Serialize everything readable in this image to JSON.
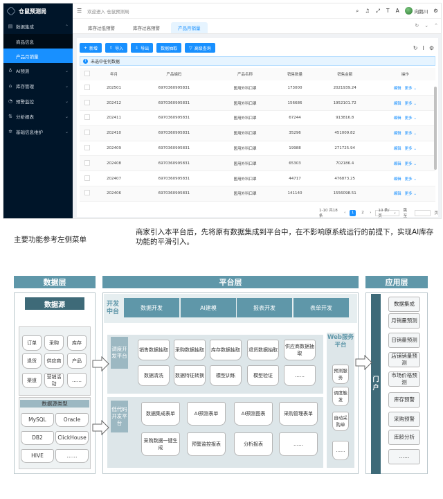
{
  "app": {
    "logo_text": "仓鼠预测局",
    "breadcrumb": "欢迎进入 仓鼠预测局",
    "user_name": "向鹅川",
    "sidebar": [
      {
        "label": "数据集成",
        "icon": "database-icon",
        "expanded": true,
        "children": [
          {
            "label": "商品信息",
            "active": false
          },
          {
            "label": "产品月销量",
            "active": true
          }
        ]
      },
      {
        "label": "AI预测",
        "icon": "bulb-icon"
      },
      {
        "label": "库存管理",
        "icon": "inventory-icon"
      },
      {
        "label": "预警监控",
        "icon": "alert-icon"
      },
      {
        "label": "分析报表",
        "icon": "report-icon"
      },
      {
        "label": "基础信息维护",
        "icon": "settings-icon"
      }
    ],
    "tabs": [
      {
        "label": "库存过低预警",
        "active": false
      },
      {
        "label": "库存过高预警",
        "active": false
      },
      {
        "label": "产品月销量",
        "active": true
      }
    ],
    "toolbar": {
      "add": "新增",
      "import": "导入",
      "export": "导出",
      "fetch": "数据抽取",
      "advanced": "高级查询"
    },
    "alert": "未选中任何数据",
    "columns": [
      "年月",
      "产品编码",
      "产品名称",
      "销售数量",
      "销售金额",
      "操作"
    ],
    "rows": [
      {
        "ym": "202501",
        "code": "6970360995831",
        "name": "医用外科口罩",
        "qty": "173000",
        "amount": "2021939.24"
      },
      {
        "ym": "202412",
        "code": "6970360995831",
        "name": "医用外科口罩",
        "qty": "156686",
        "amount": "1952101.72"
      },
      {
        "ym": "202411",
        "code": "6970360995831",
        "name": "医用外科口罩",
        "qty": "67244",
        "amount": "913816.8"
      },
      {
        "ym": "202410",
        "code": "6970360995831",
        "name": "医用外科口罩",
        "qty": "35296",
        "amount": "451009.82"
      },
      {
        "ym": "202409",
        "code": "6970360995831",
        "name": "医用外科口罩",
        "qty": "19988",
        "amount": "271725.94"
      },
      {
        "ym": "202408",
        "code": "6970360995831",
        "name": "医用外科口罩",
        "qty": "65303",
        "amount": "702186.4"
      },
      {
        "ym": "202407",
        "code": "6970360995831",
        "name": "医用外科口罩",
        "qty": "44717",
        "amount": "476873.25"
      },
      {
        "ym": "202406",
        "code": "6970360995831",
        "name": "医用外科口罩",
        "qty": "141140",
        "amount": "1556098.51"
      }
    ],
    "row_actions": {
      "edit": "编辑",
      "more": "更多"
    },
    "pager": {
      "range": "1-10 共18条",
      "page1": "1",
      "page2": "2",
      "size": "10 条/页",
      "jump": "跳至",
      "page_unit": "页"
    }
  },
  "captions": {
    "left": "主要功能参考左侧菜单",
    "right": "商家引入本平台后，先将原有数据集成到平台中，在不影响原系统运行的前提下，实现AI库存功能的平滑引入。"
  },
  "diagram": {
    "data_layer": {
      "title": "数据层",
      "source_title": "数据源",
      "sources": [
        "订单",
        "采购",
        "库存",
        "退货",
        "供应商",
        "产品",
        "渠道",
        "营销活动",
        "……"
      ],
      "db_type_title": "数据源类型",
      "db_types": [
        "MySQL",
        "Oracle",
        "DB2",
        "ClickHouse",
        "HIVE",
        "……"
      ]
    },
    "platform_layer": {
      "title": "平台层",
      "dev_center": "开发中台",
      "dev_tabs": [
        "数据开发",
        "AI建模",
        "报表开发",
        "表单开发"
      ],
      "dev_platform_title": "调度开发平台",
      "dev_platform_items": [
        "销售数据抽取",
        "采购数据抽取",
        "库存数据抽取",
        "退货数据抽取",
        "供应商数据抽取",
        "数据清洗",
        "数据特征转换",
        "模型训练",
        "模型验证",
        "……"
      ],
      "lowcode_title": "低代码开发平台",
      "lowcode_items": [
        "数据集成表单",
        "AI预测表单",
        "AI预测图表",
        "采购管理表单",
        "采购数据一键生成",
        "预警监控报表",
        "分析报表",
        "……"
      ],
      "web_title": "Web服务平台",
      "web_items": [
        "预测服务",
        "调度触发",
        "自动采购单",
        "……"
      ]
    },
    "app_layer": {
      "title": "应用层",
      "portal": "门户",
      "apps": [
        "数据集成",
        "月销量预测",
        "日销量预测",
        "店铺销量预测",
        "市场价格预测",
        "库存预警",
        "采购预警",
        "库龄分析",
        "……"
      ]
    }
  }
}
